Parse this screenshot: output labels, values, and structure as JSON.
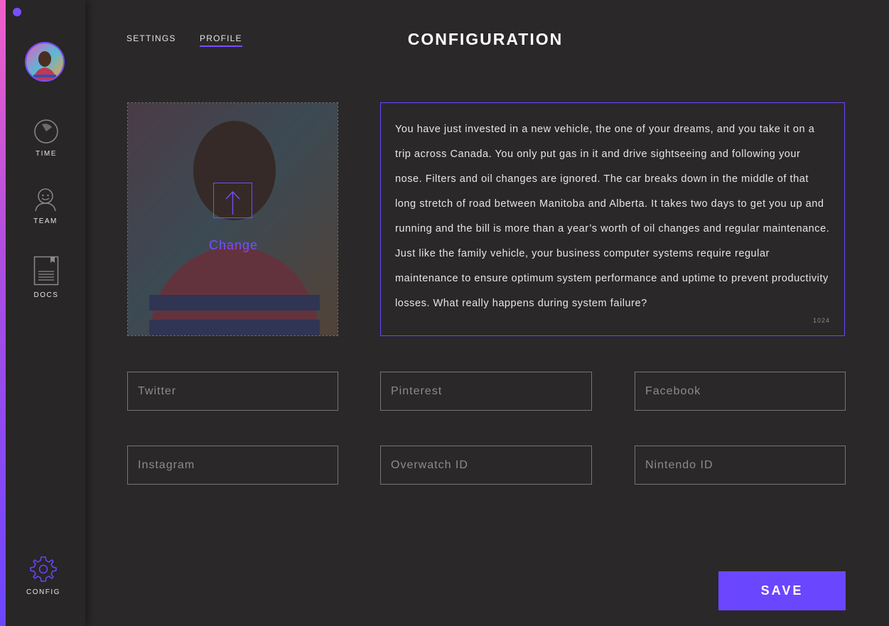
{
  "sidebar": {
    "items": [
      {
        "label": "TIME",
        "icon": "timer-icon"
      },
      {
        "label": "TEAM",
        "icon": "user-icon"
      },
      {
        "label": "DOCS",
        "icon": "document-icon"
      },
      {
        "label": "CONFIG",
        "icon": "gear-icon"
      }
    ]
  },
  "header": {
    "tabs": [
      {
        "label": "SETTINGS"
      },
      {
        "label": "PROFILE",
        "active": true
      }
    ],
    "title": "CONFIGURATION"
  },
  "profile_photo": {
    "change_label": "Change",
    "upload_icon": "upload-arrow-icon"
  },
  "bio": {
    "text": "You have just invested in a new vehicle, the one of your dreams, and you take it on a trip across Canada. You only put gas in it and drive sightseeing and following your nose. Filters and oil changes are ignored. The car breaks down in the middle of that long stretch of road between Manitoba and Alberta. It takes two days to get you up and running and the bill is more than a year’s worth of oil changes and regular maintenance. Just like the family vehicle, your business computer systems require regular maintenance to ensure optimum system performance and uptime to prevent productivity losses. What really happens during system failure?",
    "char_count": "1024"
  },
  "fields": {
    "twitter": "Twitter",
    "pinterest": "Pinterest",
    "facebook": "Facebook",
    "instagram": "Instagram",
    "overwatch": "Overwatch ID",
    "nintendo": "Nintendo ID"
  },
  "actions": {
    "save_label": "SAVE"
  },
  "colors": {
    "accent": "#6b46ff",
    "background": "#2a2829"
  }
}
